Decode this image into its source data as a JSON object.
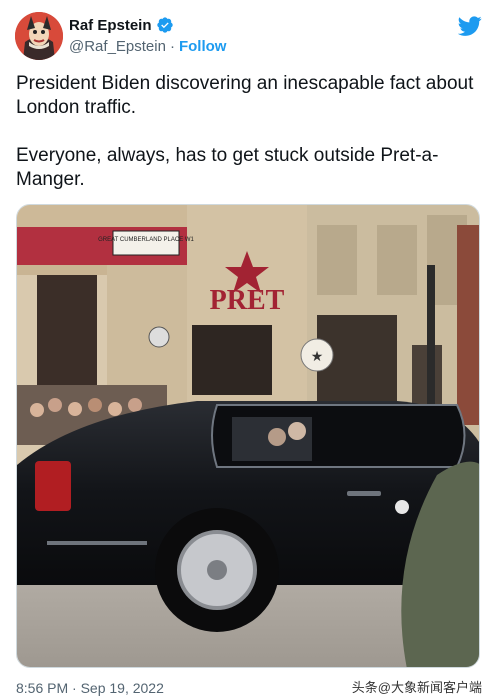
{
  "author": {
    "display_name": "Raf Epstein",
    "handle": "@Raf_Epstein",
    "separator": "·",
    "follow_label": "Follow",
    "verified": true
  },
  "tweet": {
    "line1": "President Biden discovering an inescapable fact about London traffic.",
    "line2": "Everyone, always, has to get stuck outside Pret-a-Manger."
  },
  "media": {
    "street_sign": "GREAT CUMBERLAND PLACE W1",
    "shop_sign": "PRET"
  },
  "meta": {
    "timestamp": "8:56 PM · Sep 19, 2022"
  },
  "watermark": {
    "text": "头条@大象新闻客户端"
  },
  "colors": {
    "accent": "#1d9bf0",
    "text": "#0f1419",
    "muted": "#536471"
  }
}
